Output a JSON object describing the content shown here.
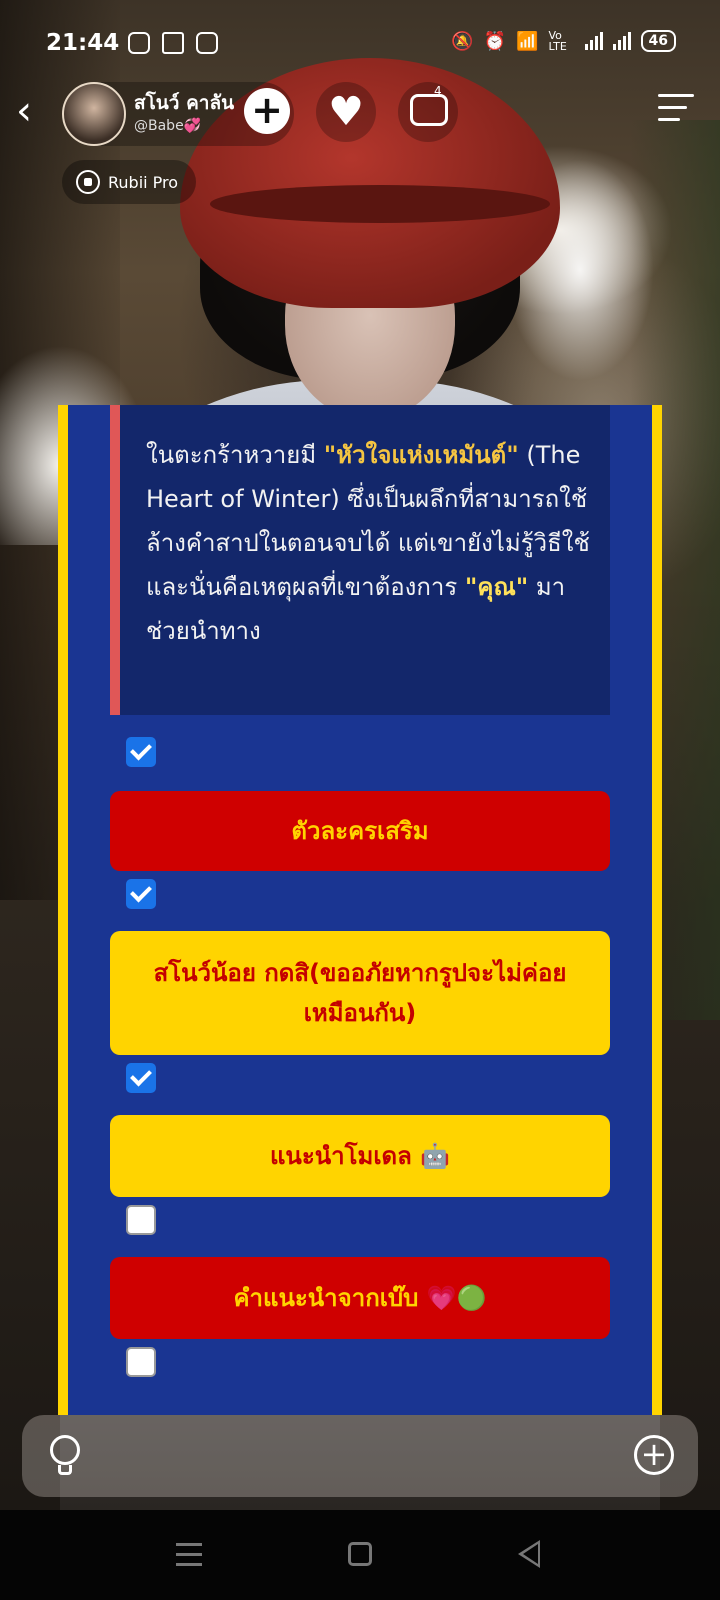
{
  "status_bar": {
    "time": "21:44",
    "network_label": "Vo LTE",
    "battery": "46",
    "icons": [
      "instagram-icon",
      "shopping-cart-icon",
      "youtube-icon",
      "mute-icon",
      "alarm-icon",
      "wifi-icon",
      "signal-icon"
    ]
  },
  "header": {
    "back_icon": "chevron-left-icon",
    "profile_name": "สโนว์ คาลัน",
    "profile_handle": "@Babe💞",
    "add_label": "+",
    "comment_count": "4",
    "badge_label": "Rubii Pro"
  },
  "card": {
    "quote_text_parts": {
      "a": "ในตะกร้าหวายมี ",
      "b": "\"หัวใจแห่งเหมันต์\"",
      "c": " (The Heart of Winter) ซึ่งเป็นผลึกที่สามารถใช้ล้างคำสาปในตอนจบได้ แต่เขายังไม่รู้วิธีใช้ และนั่นคือเหตุผลที่เขาต้องการ ",
      "d": "\"คุณ\"",
      "e": " มาช่วยนำทาง"
    },
    "options": [
      {
        "label": "ตัวละครเสริม",
        "checked": true,
        "style": "red"
      },
      {
        "label": "สโนว์น้อย กดสิ(ขออภัยหากรูปจะไม่ค่อยเหมือนกัน)",
        "checked": true,
        "style": "yellow"
      },
      {
        "label": "แนะนำโมเดล 🤖",
        "checked": true,
        "style": "yellow"
      },
      {
        "label": "คำแนะนำจากเบ๊บ 💗🟢",
        "checked": false,
        "style": "red"
      }
    ],
    "colors": {
      "panel": "#1a3592",
      "border": "#ffd400",
      "red_button": "#cf0000",
      "yellow_button": "#ffd400",
      "checkbox": "#1a73e8"
    }
  },
  "input_bar": {
    "left_icon": "lightbulb-icon",
    "right_icon": "plus-circle-icon"
  }
}
